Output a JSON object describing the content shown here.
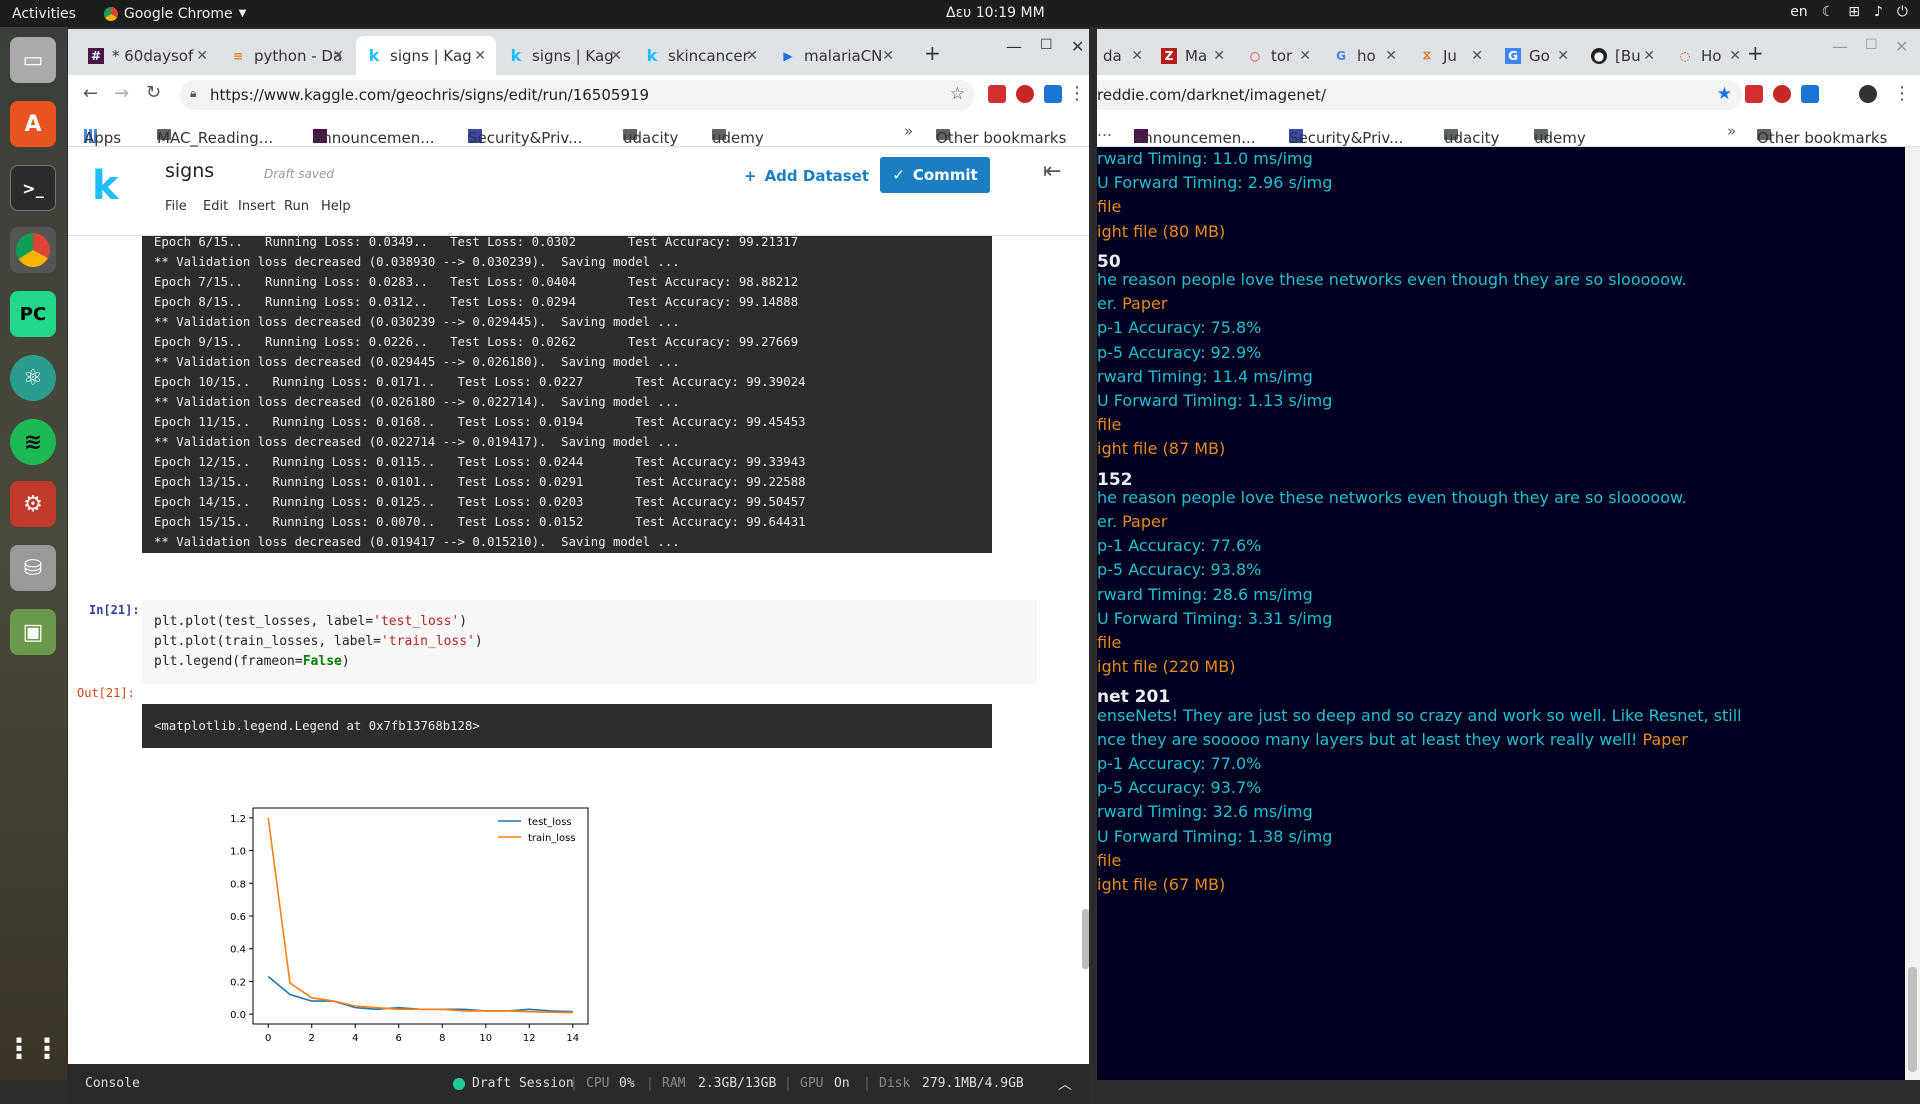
{
  "topbar": {
    "activities": "Activities",
    "app": "Google Chrome",
    "clock": "Δευ 10:19 ΜΜ",
    "lang": "en"
  },
  "left": {
    "tabs": [
      "* 60daysof",
      "python - Da",
      "signs | Kag",
      "signs | Kag",
      "skincancer",
      "malariaCN"
    ],
    "url": "https://www.kaggle.com/geochris/signs/edit/run/16505919",
    "bookmarks": [
      "Apps",
      "MAC_Reading...",
      "announcemen...",
      "Security&Priv...",
      "udacity",
      "udemy",
      "Other bookmarks"
    ],
    "kaggle": {
      "title": "signs",
      "status": "Draft saved",
      "menu": [
        "File",
        "Edit",
        "Insert",
        "Run",
        "Help"
      ],
      "add_dataset": "Add Dataset",
      "commit": "Commit"
    },
    "training_log": [
      "Epoch 6/15..   Running Loss: 0.0349..   Test Loss: 0.0302       Test Accuracy: 99.21317",
      "** Validation loss decreased (0.038930 --> 0.030239).  Saving model ...",
      "Epoch 7/15..   Running Loss: 0.0283..   Test Loss: 0.0404       Test Accuracy: 98.88212",
      "Epoch 8/15..   Running Loss: 0.0312..   Test Loss: 0.0294       Test Accuracy: 99.14888",
      "** Validation loss decreased (0.030239 --> 0.029445).  Saving model ...",
      "Epoch 9/15..   Running Loss: 0.0226..   Test Loss: 0.0262       Test Accuracy: 99.27669",
      "** Validation loss decreased (0.029445 --> 0.026180).  Saving model ...",
      "Epoch 10/15..   Running Loss: 0.0171..   Test Loss: 0.0227       Test Accuracy: 99.39024",
      "** Validation loss decreased (0.026180 --> 0.022714).  Saving model ...",
      "Epoch 11/15..   Running Loss: 0.0168..   Test Loss: 0.0194       Test Accuracy: 99.45453",
      "** Validation loss decreased (0.022714 --> 0.019417).  Saving model ...",
      "Epoch 12/15..   Running Loss: 0.0115..   Test Loss: 0.0244       Test Accuracy: 99.33943",
      "Epoch 13/15..   Running Loss: 0.0101..   Test Loss: 0.0291       Test Accuracy: 99.22588",
      "Epoch 14/15..   Running Loss: 0.0125..   Test Loss: 0.0203       Test Accuracy: 99.50457",
      "Epoch 15/15..   Running Loss: 0.0070..   Test Loss: 0.0152       Test Accuracy: 99.64431",
      "** Validation loss decreased (0.019417 --> 0.015210).  Saving model ..."
    ],
    "cell_in": "In[21]:",
    "code": [
      "plt.plot(test_losses, label='test_loss')",
      "plt.plot(train_losses, label='train_loss')",
      "plt.legend(frameon=False)"
    ],
    "cell_out": "Out[21]:",
    "out_text": "<matplotlib.legend.Legend at 0x7fb13768b128>",
    "console": {
      "label": "Console",
      "session": "Draft Session",
      "cpu_label": "CPU",
      "cpu": "0%",
      "ram_label": "RAM",
      "ram": "2.3GB/13GB",
      "gpu_label": "GPU",
      "gpu": "On",
      "disk_label": "Disk",
      "disk": "279.1MB/4.9GB"
    }
  },
  "chart_data": {
    "type": "line",
    "x": [
      0,
      1,
      2,
      3,
      4,
      5,
      6,
      7,
      8,
      9,
      10,
      11,
      12,
      13,
      14
    ],
    "series": [
      {
        "name": "test_loss",
        "color": "#1f77b4",
        "values": [
          0.23,
          0.12,
          0.08,
          0.08,
          0.04,
          0.03,
          0.04,
          0.03,
          0.03,
          0.03,
          0.02,
          0.02,
          0.03,
          0.02,
          0.015
        ]
      },
      {
        "name": "train_loss",
        "color": "#ff7f0e",
        "values": [
          1.2,
          0.19,
          0.1,
          0.08,
          0.05,
          0.04,
          0.03,
          0.03,
          0.03,
          0.02,
          0.02,
          0.02,
          0.015,
          0.012,
          0.01
        ]
      }
    ],
    "xticks": [
      "0",
      "2",
      "4",
      "6",
      "8",
      "10",
      "12",
      "14"
    ],
    "yticks": [
      "0.0",
      "0.2",
      "0.4",
      "0.6",
      "0.8",
      "1.0",
      "1.2"
    ],
    "xlim": [
      -0.7,
      14.7
    ],
    "ylim": [
      -0.06,
      1.26
    ],
    "legend": "top-right"
  },
  "right": {
    "tabs": [
      "da",
      "Ma",
      "tor",
      "ho",
      "Ju",
      "Go",
      "[Bu",
      "Ho"
    ],
    "url": "reddie.com/darknet/imagenet/",
    "bookmarks": [
      "announcemen...",
      "Security&Priv...",
      "udacity",
      "udemy",
      "Other bookmarks"
    ],
    "lines": [
      {
        "t": "rward Timing: 11.0 ms/img"
      },
      {
        "t": "U Forward Timing: 2.96 s/img"
      },
      {
        "o": "file"
      },
      {
        "o": "ight file (80 MB)"
      },
      {
        "h": "50"
      },
      {
        "t": "he reason people love these networks even though they are so slooooow."
      },
      {
        "t": "er. ",
        "o": "Paper"
      },
      {
        "t": "p-1 Accuracy: 75.8%"
      },
      {
        "t": "p-5 Accuracy: 92.9%"
      },
      {
        "t": "rward Timing: 11.4 ms/img"
      },
      {
        "t": "U Forward Timing: 1.13 s/img"
      },
      {
        "o": "file"
      },
      {
        "o": "ight file (87 MB)"
      },
      {
        "h": "152"
      },
      {
        "t": "he reason people love these networks even though they are so slooooow."
      },
      {
        "t": "er. ",
        "o": "Paper"
      },
      {
        "t": "p-1 Accuracy: 77.6%"
      },
      {
        "t": "p-5 Accuracy: 93.8%"
      },
      {
        "t": "rward Timing: 28.6 ms/img"
      },
      {
        "t": "U Forward Timing: 3.31 s/img"
      },
      {
        "o": "file"
      },
      {
        "o": "ight file (220 MB)"
      },
      {
        "h": "net 201"
      },
      {
        "t": "enseNets! They are just so deep and so crazy and work so well. Like Resnet, still"
      },
      {
        "t": "nce they are sooooo many layers but at least they work really well! ",
        "o": "Paper"
      },
      {
        "t": "p-1 Accuracy: 77.0%"
      },
      {
        "t": "p-5 Accuracy: 93.7%"
      },
      {
        "t": "rward Timing: 32.6 ms/img"
      },
      {
        "t": "U Forward Timing: 1.38 s/img"
      },
      {
        "o": "file"
      },
      {
        "o": "ight file (67 MB)"
      }
    ]
  }
}
